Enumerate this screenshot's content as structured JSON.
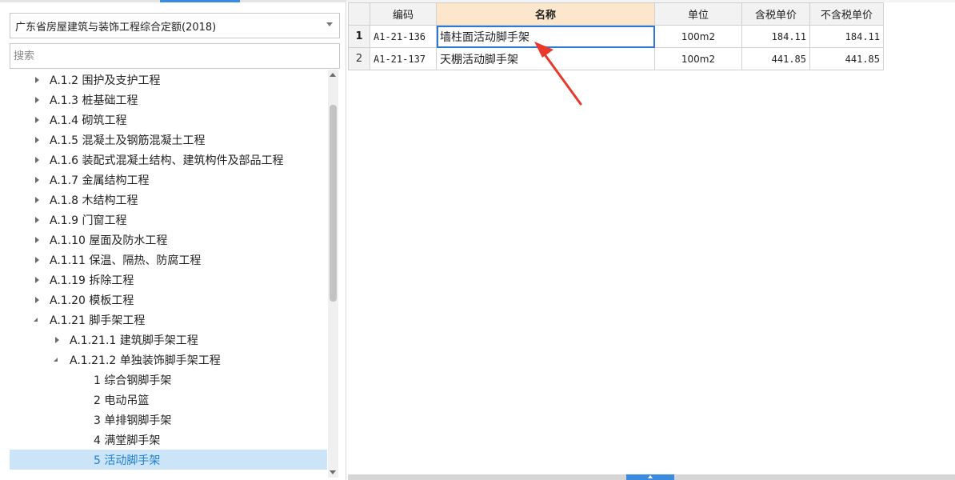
{
  "library": {
    "selected": "广东省房屋建筑与装饰工程综合定额(2018)"
  },
  "search": {
    "placeholder": "搜索"
  },
  "tree": {
    "items": [
      {
        "label": "A.1.2 围护及支护工程",
        "state": "collapsed"
      },
      {
        "label": "A.1.3 桩基础工程",
        "state": "collapsed"
      },
      {
        "label": "A.1.4 砌筑工程",
        "state": "collapsed"
      },
      {
        "label": "A.1.5 混凝土及钢筋混凝土工程",
        "state": "collapsed"
      },
      {
        "label": "A.1.6 装配式混凝土结构、建筑构件及部品工程",
        "state": "collapsed"
      },
      {
        "label": "A.1.7 金属结构工程",
        "state": "collapsed"
      },
      {
        "label": "A.1.8 木结构工程",
        "state": "collapsed"
      },
      {
        "label": "A.1.9 门窗工程",
        "state": "collapsed"
      },
      {
        "label": "A.1.10 屋面及防水工程",
        "state": "collapsed"
      },
      {
        "label": "A.1.11 保温、隔热、防腐工程",
        "state": "collapsed"
      },
      {
        "label": "A.1.19 拆除工程",
        "state": "collapsed"
      },
      {
        "label": "A.1.20 模板工程",
        "state": "collapsed"
      },
      {
        "label": "A.1.21 脚手架工程",
        "state": "expanded"
      },
      {
        "label": "A.1.21.1 建筑脚手架工程",
        "state": "collapsed"
      },
      {
        "label": "A.1.21.2 单独装饰脚手架工程",
        "state": "expanded"
      },
      {
        "label": "1 综合钢脚手架",
        "state": "leaf"
      },
      {
        "label": "2 电动吊篮",
        "state": "leaf"
      },
      {
        "label": "3 单排钢脚手架",
        "state": "leaf"
      },
      {
        "label": "4 满堂脚手架",
        "state": "leaf"
      },
      {
        "label": "5 活动脚手架",
        "state": "leaf",
        "selected": true
      }
    ]
  },
  "grid": {
    "columns": [
      "编码",
      "名称",
      "单位",
      "含税单价",
      "不含税单价"
    ],
    "rows": [
      {
        "num": "1",
        "code": "A1-21-136",
        "name": "墙柱面活动脚手架",
        "unit": "100m2",
        "price_tax": "184.11",
        "price_notax": "184.11"
      },
      {
        "num": "2",
        "code": "A1-21-137",
        "name": "天棚活动脚手架",
        "unit": "100m2",
        "price_tax": "441.85",
        "price_notax": "441.85"
      }
    ]
  },
  "colors": {
    "selected_row_bg": "#cce4f7",
    "selected_row_text": "#1e7fd6",
    "name_header_bg": "#fde7cc",
    "active_cell_border": "#2b78d6",
    "annotation_arrow": "#e8392c",
    "splitter_handle": "#3b8be0"
  }
}
